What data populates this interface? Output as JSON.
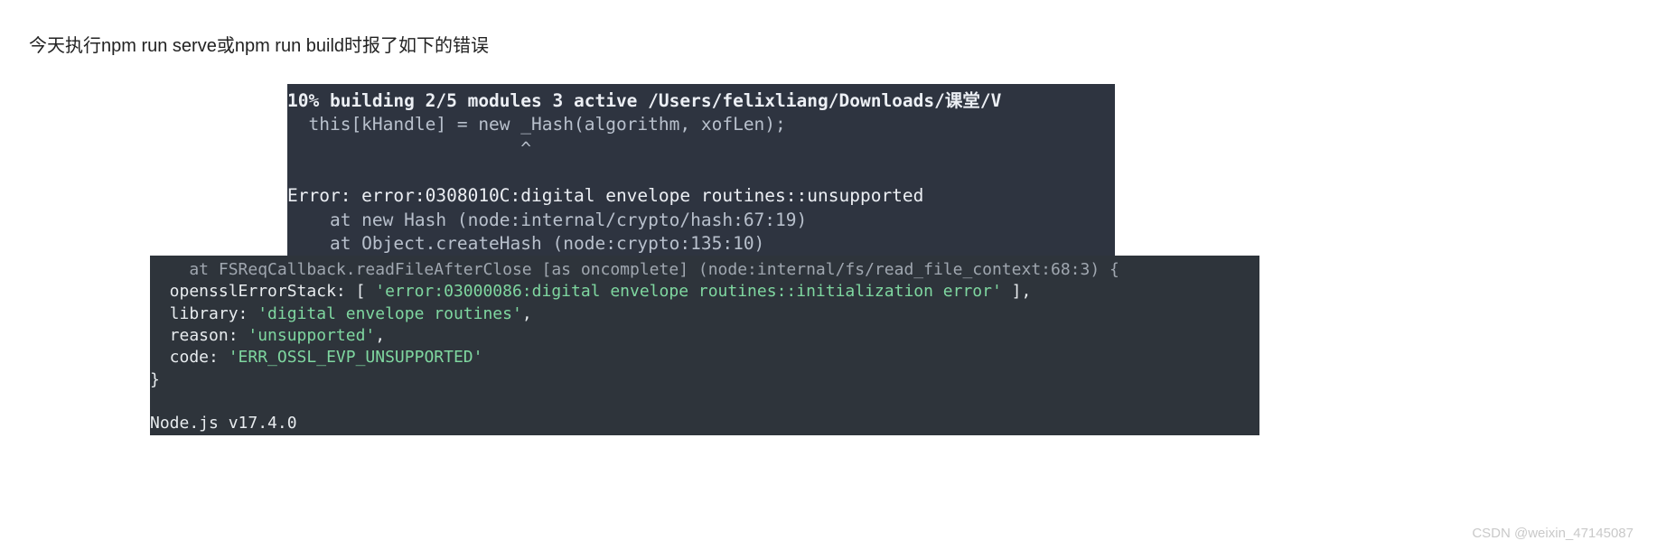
{
  "intro": "今天执行npm run serve或npm run build时报了如下的错误",
  "term1": {
    "l1": "10% building 2/5 modules 3 active /Users/felixliang/Downloads/课堂/V",
    "l2": "  this[kHandle] = new _Hash(algorithm, xofLen);",
    "l3": "                      ^",
    "l4": "",
    "l5": "Error: error:0308010C:digital envelope routines::unsupported",
    "l6": "    at new Hash (node:internal/crypto/hash:67:19)",
    "l7": "    at Object.createHash (node:crypto:135:10)"
  },
  "term2": {
    "l1": "    at FSReqCallback.readFileAfterClose [as oncomplete] (node:internal/fs/read_file_context:68:3) {",
    "l2a": "  opensslErrorStack: [ ",
    "l2b": "'error:03000086:digital envelope routines::initialization error'",
    "l2c": " ],",
    "l3a": "  library: ",
    "l3b": "'digital envelope routines'",
    "l3c": ",",
    "l4a": "  reason: ",
    "l4b": "'unsupported'",
    "l4c": ",",
    "l5a": "  code: ",
    "l5b": "'ERR_OSSL_EVP_UNSUPPORTED'",
    "l6": "}",
    "l7": "",
    "l8": "Node.js v17.4.0"
  },
  "watermark": "CSDN @weixin_47145087"
}
